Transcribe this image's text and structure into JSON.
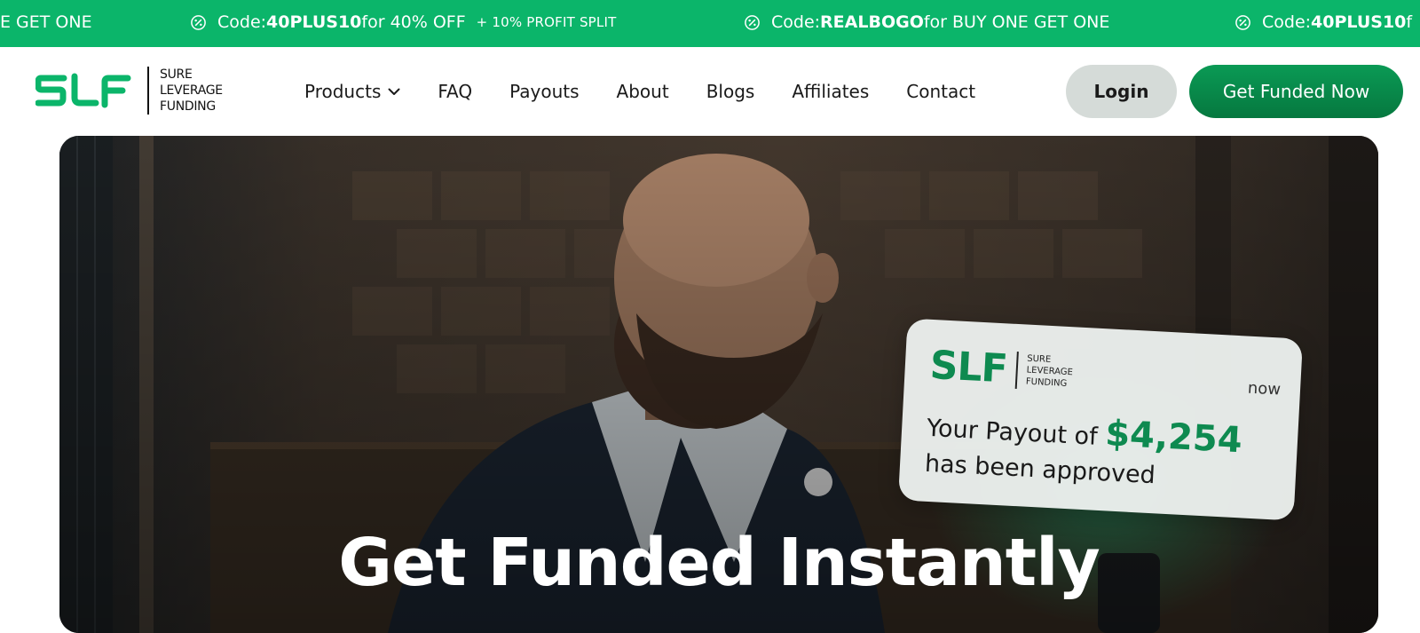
{
  "ticker": {
    "fragment": "E GET ONE",
    "promos": [
      {
        "prefix": "Code: ",
        "code": "40PLUS10",
        "suffix": " for 40% OFF",
        "extra": "+ 10% PROFIT SPLIT"
      },
      {
        "prefix": "Code: ",
        "code": "REALBOGO",
        "suffix": " for BUY ONE GET ONE",
        "extra": ""
      },
      {
        "prefix": "Code: ",
        "code": "40PLUS10",
        "suffix": " f",
        "extra": ""
      }
    ],
    "icon": "discount-badge-icon"
  },
  "header": {
    "logo": {
      "mark": "SLF",
      "line1": "SURE",
      "line2": "LEVERAGE",
      "line3": "FUNDING"
    },
    "nav": [
      {
        "label": "Products",
        "has_dropdown": true
      },
      {
        "label": "FAQ"
      },
      {
        "label": "Payouts"
      },
      {
        "label": "About"
      },
      {
        "label": "Blogs"
      },
      {
        "label": "Affiliates"
      },
      {
        "label": "Contact"
      }
    ],
    "login_label": "Login",
    "cta_label": "Get Funded Now"
  },
  "hero": {
    "title": "Get Funded Instantly",
    "notification": {
      "logo": {
        "mark": "SLF",
        "line1": "SURE",
        "line2": "LEVERAGE",
        "line3": "FUNDING"
      },
      "time": "now",
      "message_start": "Your Payout of ",
      "amount": "$4,254",
      "message_end": "has been approved"
    }
  },
  "colors": {
    "brand_green": "#0bb56a",
    "dark_green": "#06783f",
    "login_bg": "#d5dbd8"
  }
}
